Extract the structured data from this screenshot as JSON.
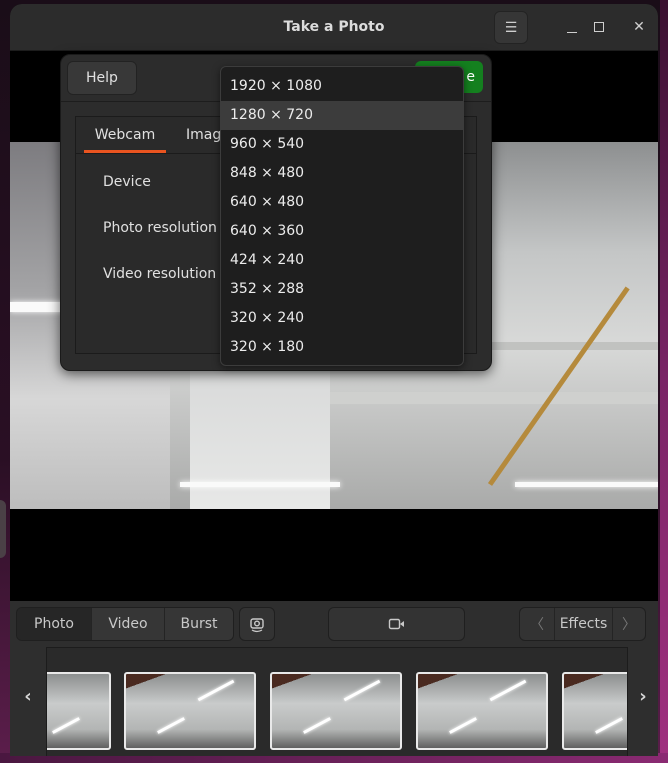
{
  "window": {
    "title": "Take a Photo",
    "menu_icon": "hamburger-menu-icon",
    "minimize_icon": "minimize-icon",
    "maximize_icon": "maximize-icon",
    "close_icon": "close-icon",
    "close_glyph": "✕",
    "menu_glyph": "☰"
  },
  "dialog": {
    "help_label": "Help",
    "done_label": "e",
    "done_color": "#14801f",
    "tabs": [
      {
        "label": "Webcam",
        "active": true,
        "accent": "#e95420"
      },
      {
        "label": "Image",
        "active": false
      }
    ],
    "settings": [
      {
        "label": "Device"
      },
      {
        "label": "Photo resolution"
      },
      {
        "label": "Video resolution"
      }
    ]
  },
  "resolution_dropdown": {
    "highlighted_index": 1,
    "options": [
      "1920 × 1080",
      "1280 × 720",
      "960 × 540",
      "848 × 480",
      "640 × 480",
      "640 × 360",
      "424 × 240",
      "352 × 288",
      "320 × 240",
      "320 × 180"
    ]
  },
  "toolbar": {
    "modes": [
      {
        "label": "Photo",
        "active": true
      },
      {
        "label": "Video",
        "active": false
      },
      {
        "label": "Burst",
        "active": false
      }
    ],
    "switch_camera_icon": "switch-camera-icon",
    "capture_icon": "video-camera-icon",
    "effects": {
      "label": "Effects",
      "prev_glyph": "〈",
      "next_glyph": "〉"
    }
  },
  "thumbnail_strip": {
    "prev_glyph": "‹",
    "next_glyph": "›",
    "thumbnail_count": 5
  }
}
